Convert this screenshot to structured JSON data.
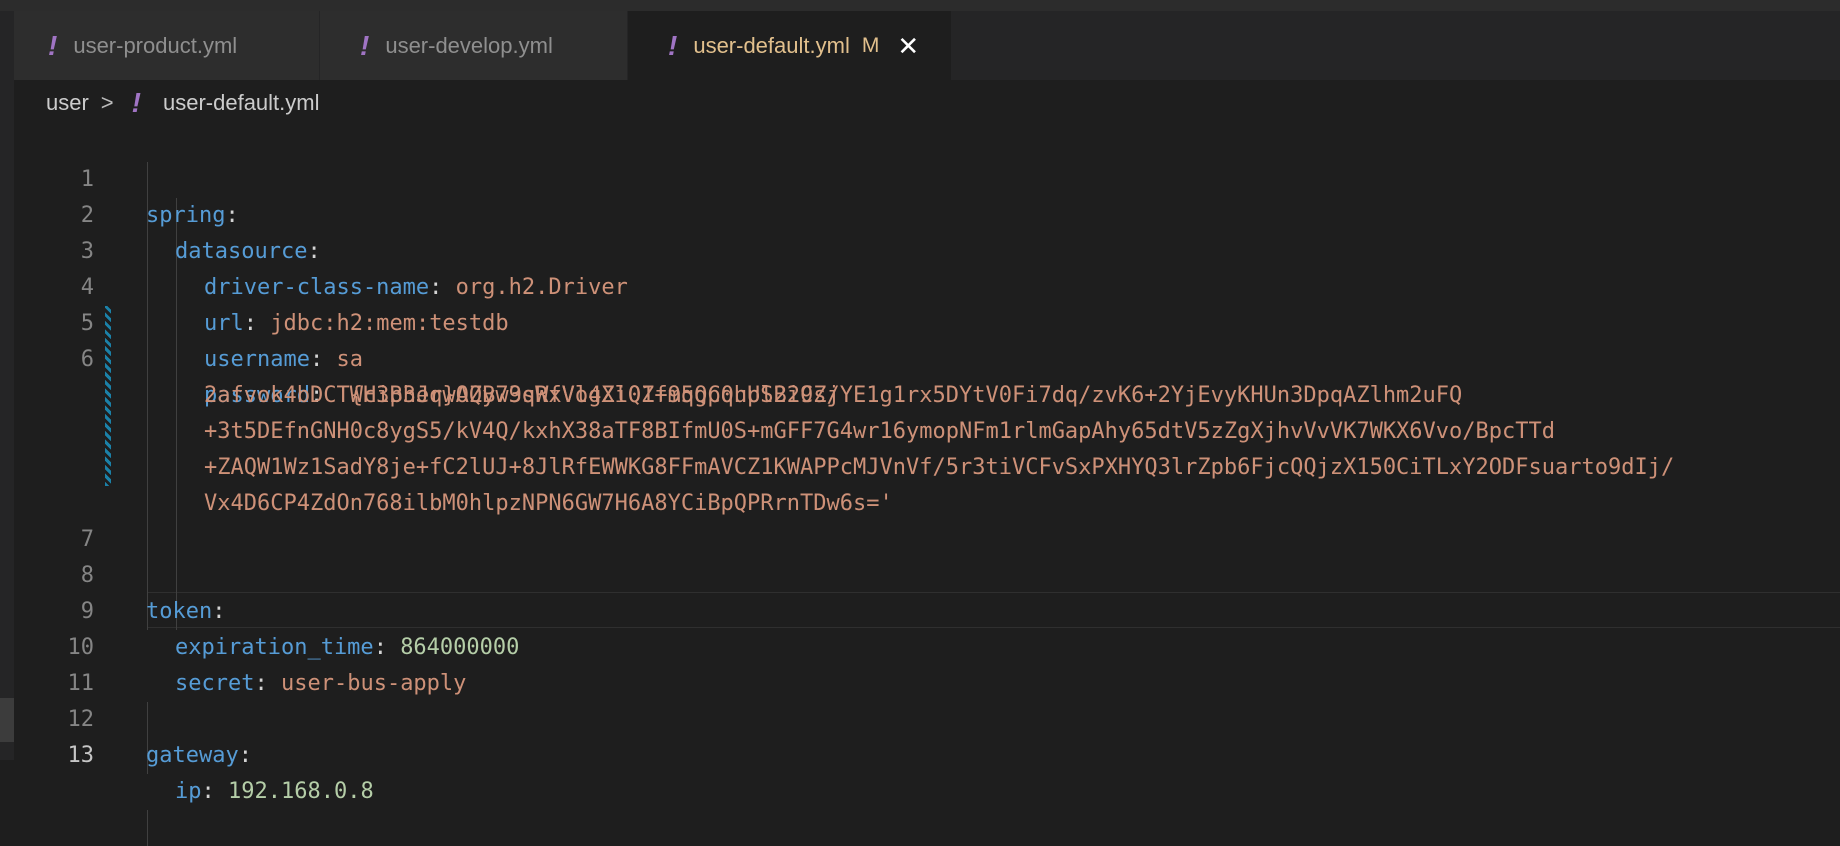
{
  "tabs": [
    {
      "label": "user-product.yml",
      "icon": "!"
    },
    {
      "label": "user-develop.yml",
      "icon": "!"
    },
    {
      "label": "user-default.yml",
      "icon": "!",
      "modified": "M",
      "close": "✕"
    }
  ],
  "breadcrumb": {
    "folder": "user",
    "separator": ">",
    "icon": "!",
    "file": "user-default.yml"
  },
  "lines": [
    {
      "num": "1",
      "key": "spring",
      "colon": ":"
    },
    {
      "num": "2",
      "key": "datasource",
      "colon": ":"
    },
    {
      "num": "3",
      "key": "driver-class-name",
      "colon": ": ",
      "value": "org.h2.Driver"
    },
    {
      "num": "4",
      "key": "url",
      "colon": ": ",
      "value": "jdbc:h2:mem:testdb"
    },
    {
      "num": "5",
      "key": "username",
      "colon": ": ",
      "value": "sa"
    },
    {
      "num": "6",
      "key": "password",
      "colon": ": ",
      "value": "'{cipher}AQB73sWxVo4XlQ1+m5gp0upl229s/",
      "wrap": [
        "2afvok4bDCTWH3B3JqwOZyw9qRfVlgZi0Zf9qQCqhUSBiCZjYE1g1rx5DYtV0Fi7dq/zvK6+2YjEvyKHUn3DpqAZlhm2uFQ",
        "+3t5DEfnGNH0c8ygS5/kV4Q/kxhX38aTF8BIfmU0S+mGFF7G4wr16ymopNFm1rlmGapAhy65dtV5zZgXjhvVvVK7WKX6Vvo/BpcTTd",
        "+ZAQW1Wz1SadY8je+fC2lUJ+8JlRfEWWKG8FFmAVCZ1KWAPPcMJVnVf/5r3tiVCFvSxPXHYQ3lrZpb6FjcQQjzX150CiTLxY2ODFsuarto9dIj/",
        "Vx4D6CP4ZdOn768ilbM0hlpzNPN6GW7H6A8YCiBpQPRrnTDw6s='"
      ]
    },
    {
      "num": "7"
    },
    {
      "num": "8",
      "key": "token",
      "colon": ":"
    },
    {
      "num": "9",
      "key": "expiration_time",
      "colon": ": ",
      "value": "864000000"
    },
    {
      "num": "10",
      "key": "secret",
      "colon": ": ",
      "value": "user-bus-apply"
    },
    {
      "num": "11"
    },
    {
      "num": "12",
      "key": "gateway",
      "colon": ":"
    },
    {
      "num": "13",
      "key": "ip",
      "colon": ": ",
      "value": "192.168.0.8"
    }
  ],
  "colors": {
    "key": "#569cd6",
    "string": "#ce9178",
    "number": "#b5cea8",
    "modified": "#e2c08d",
    "yaml_icon": "#a074c4"
  }
}
